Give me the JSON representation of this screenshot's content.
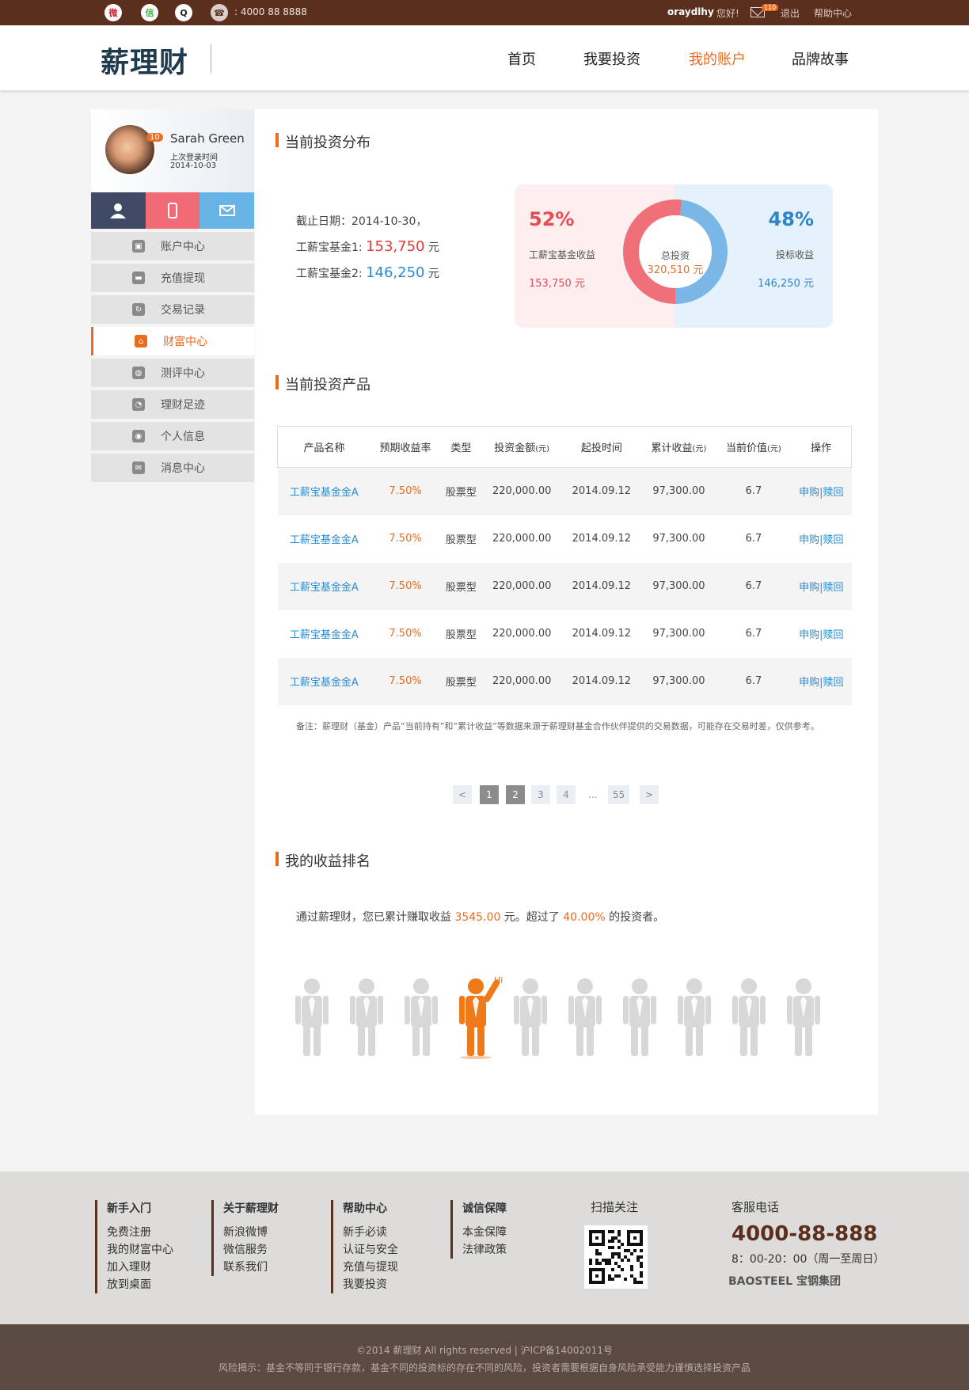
{
  "topbar": {
    "phone": ": 4000 88 8888",
    "username": "oraydlhy",
    "greeting": "您好!",
    "mail_badge": "110",
    "logout": "退出",
    "help": "帮助中心"
  },
  "header": {
    "logo": "薪理财",
    "nav": [
      {
        "label": "首页"
      },
      {
        "label": "我要投资"
      },
      {
        "label": "我的账户"
      },
      {
        "label": "品牌故事"
      }
    ]
  },
  "profile": {
    "name": "Sarah Green",
    "level": "10",
    "last_login_label": "上次登录时间",
    "last_login_date": "2014-10-03"
  },
  "sidebar": {
    "items": [
      {
        "label": "账户中心"
      },
      {
        "label": "充值提现"
      },
      {
        "label": "交易记录"
      },
      {
        "label": "财富中心"
      },
      {
        "label": "测评中心"
      },
      {
        "label": "理财足迹"
      },
      {
        "label": "个人信息"
      },
      {
        "label": "消息中心"
      }
    ]
  },
  "distribution": {
    "title": "当前投资分布",
    "date_line": "截止日期：2014-10-30，",
    "fund1_label": "工薪宝基金1:",
    "fund1_value": "153,750",
    "fund2_label": "工薪宝基金2:",
    "fund2_value": "146,250",
    "unit": "元",
    "left_pct": "52%",
    "left_label": "工薪宝基金收益",
    "left_value": "153,750 元",
    "right_pct": "48%",
    "right_label": "投标收益",
    "right_value": "146,250 元",
    "center_label": "总投资",
    "center_value": "320,510 元"
  },
  "chart_data": {
    "type": "pie",
    "categories": [
      "工薪宝基金收益",
      "投标收益"
    ],
    "values": [
      52,
      48
    ],
    "colors": [
      "#f0707a",
      "#7bb7e6"
    ]
  },
  "products": {
    "title": "当前投资产品",
    "headers": [
      "产品名称",
      "预期收益率",
      "类型",
      "投资金额",
      "起投时间",
      "累计收益",
      "当前价值",
      "操作"
    ],
    "unit_suffix": "(元)",
    "rows": [
      {
        "name": "工薪宝基金金A",
        "rate": "7.50%",
        "type": "股票型",
        "amount": "220,000.00",
        "start": "2014.09.12",
        "income": "97,300.00",
        "value": "6.7",
        "action": "申购|赎回"
      },
      {
        "name": "工薪宝基金金A",
        "rate": "7.50%",
        "type": "股票型",
        "amount": "220,000.00",
        "start": "2014.09.12",
        "income": "97,300.00",
        "value": "6.7",
        "action": "申购|赎回"
      },
      {
        "name": "工薪宝基金金A",
        "rate": "7.50%",
        "type": "股票型",
        "amount": "220,000.00",
        "start": "2014.09.12",
        "income": "97,300.00",
        "value": "6.7",
        "action": "申购|赎回"
      },
      {
        "name": "工薪宝基金金A",
        "rate": "7.50%",
        "type": "股票型",
        "amount": "220,000.00",
        "start": "2014.09.12",
        "income": "97,300.00",
        "value": "6.7",
        "action": "申购|赎回"
      },
      {
        "name": "工薪宝基金金A",
        "rate": "7.50%",
        "type": "股票型",
        "amount": "220,000.00",
        "start": "2014.09.12",
        "income": "97,300.00",
        "value": "6.7",
        "action": "申购|赎回"
      }
    ],
    "note": "备注：薪理财（基金）产品“当前持有”和“累计收益”等数据来源于薪理财基金合作伙伴提供的交易数据，可能存在交易时差，仅供参考。",
    "pager": [
      "<",
      "1",
      "2",
      "3",
      "4",
      "...",
      "55",
      ">"
    ]
  },
  "ranking": {
    "title": "我的收益排名",
    "text_pre": "通过薪理财，您已累计赚取收益 ",
    "amount": "3545.00",
    "text_mid": " 元。超过了 ",
    "percent": "40.00%",
    "text_post": " 的投资者。",
    "hi": "Hi",
    "highlight_index": 3
  },
  "footer": {
    "cols": [
      {
        "title": "新手入门",
        "items": [
          "免费注册",
          "我的财富中心",
          "加入理财",
          "放到桌面"
        ]
      },
      {
        "title": "关于薪理财",
        "items": [
          "新浪微博",
          "微信服务",
          "联系我们"
        ]
      },
      {
        "title": "帮助中心",
        "items": [
          "新手必读",
          "认证与安全",
          "充值与提现",
          "我要投资"
        ]
      },
      {
        "title": "诚信保障",
        "items": [
          "本金保障",
          "法律政策"
        ]
      }
    ],
    "qr_title": "扫描关注",
    "service_title": "客服电话",
    "service_phone": "4000-88-888",
    "service_hours": "8：00-20：00（周一至周日）",
    "partner": "BAOSTEEL 宝钢集团"
  },
  "copyright": {
    "line1": "©2014 薪理财 All rights reserved | 沪ICP备14002011号",
    "line2": "风险揭示：基金不等同于银行存款，基金不同的投资标的存在不同的风险，投资者需要根据自身风险承受能力谨慎选择投资产品"
  }
}
